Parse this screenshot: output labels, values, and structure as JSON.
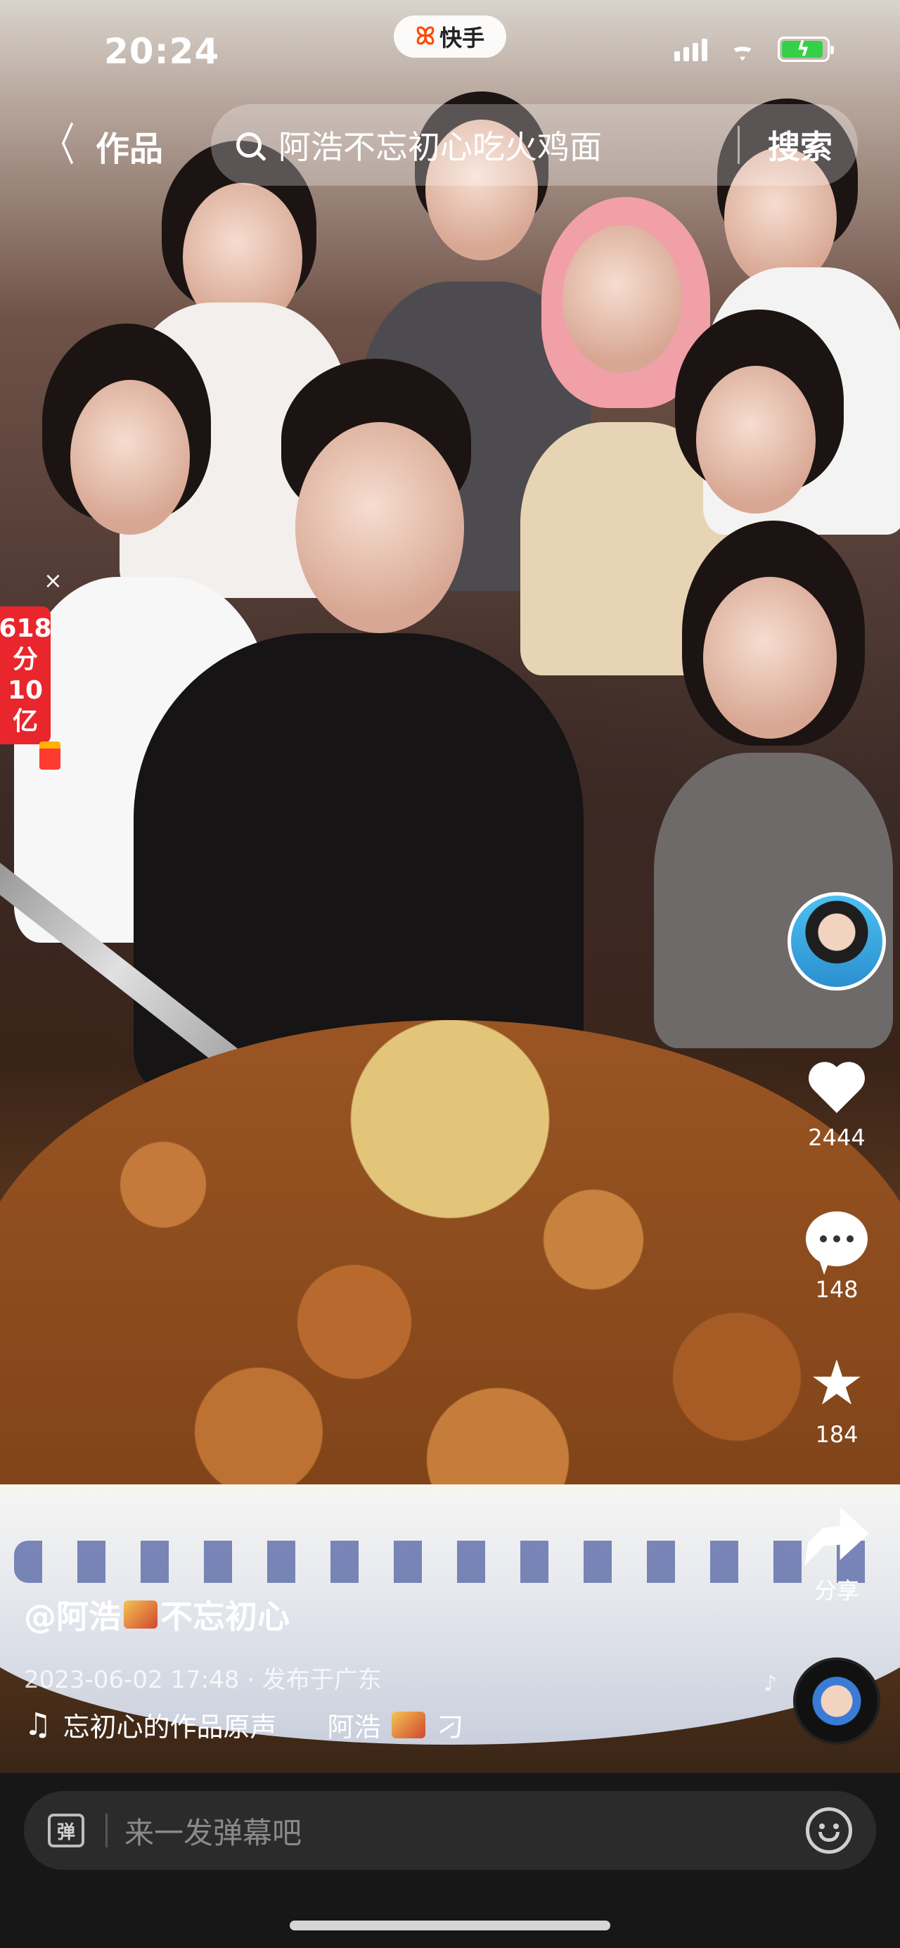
{
  "status_bar": {
    "time": "20:24",
    "app_pill_label": "快手",
    "app_pill_icon": "kuaishou-logo-icon",
    "battery_color": "#35d04a"
  },
  "header": {
    "back_label": "作品",
    "search_text": "阿浩不忘初心吃火鸡面",
    "search_button": "搜索"
  },
  "promo": {
    "lines": [
      "618",
      "分",
      "10",
      "亿"
    ],
    "close_label": "×",
    "color": "#e8262c"
  },
  "actions": {
    "likes": "2444",
    "comments": "148",
    "favorites": "184",
    "share_label": "分享"
  },
  "caption": {
    "author_prefix": "@阿浩",
    "author_suffix": "不忘初心",
    "date_location": "2023-06-02 17:48 · 发布于广东",
    "music_left": "忘初心的作品原声",
    "music_right": "阿浩",
    "music_tail": "刁"
  },
  "bottom_bar": {
    "danmaku_toggle": "弹",
    "input_placeholder": "来一发弹幕吧"
  }
}
